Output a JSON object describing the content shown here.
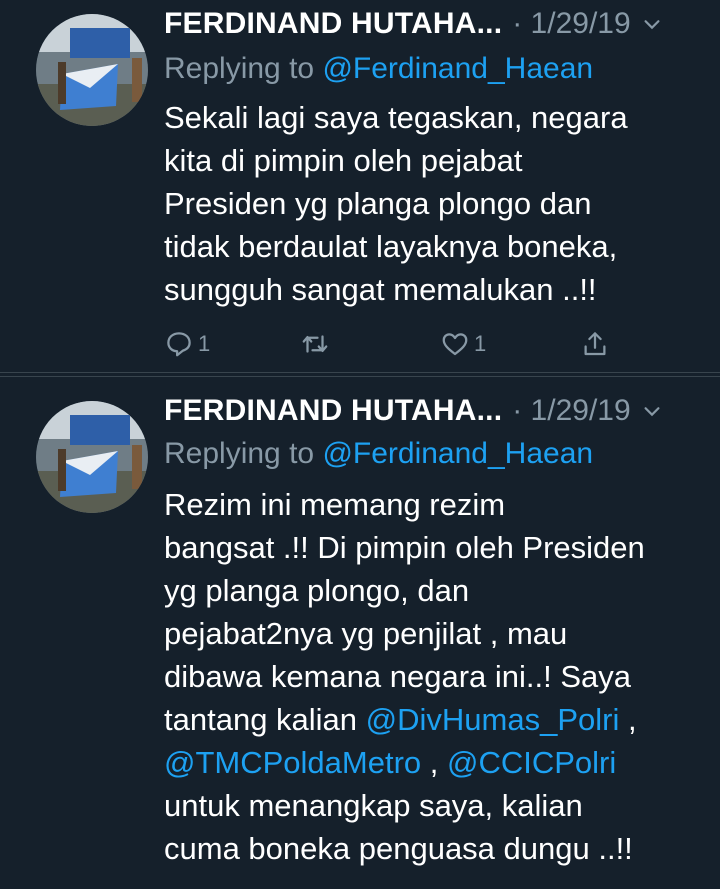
{
  "tweets": [
    {
      "author": "FERDINAND HUTAHA...",
      "date": "· 1/29/19",
      "replying_prefix": "Replying to",
      "replying_handle": "@Ferdinand_Haean",
      "body_lines": [
        "Sekali lagi saya tegaskan, negara",
        "kita di pimpin oleh pejabat",
        "Presiden yg planga plongo dan",
        "tidak berdaulat layaknya boneka,",
        "sungguh sangat memalukan ..!!"
      ],
      "actions": {
        "reply_count": "1",
        "retweet_count": "",
        "like_count": "1"
      }
    },
    {
      "author": "FERDINAND HUTAHA...",
      "date": "· 1/29/19",
      "replying_prefix": "Replying to",
      "replying_handle": "@Ferdinand_Haean",
      "body": {
        "l1": "Rezim ini memang rezim",
        "l2": "bangsat .!! Di pimpin oleh Presiden",
        "l3": "yg planga plongo,  dan",
        "l4": "pejabat2nya yg penjilat , mau",
        "l5": "dibawa kemana negara ini..! Saya",
        "l6_text": "tantang kalian ",
        "l6_mention": "@DivHumas_Polri",
        "l6_after": " ,",
        "l7_mention1": "@TMCPoldaMetro",
        "l7_sep": " , ",
        "l7_mention2": "@CCICPolri",
        "l8": "untuk menangkap saya, kalian",
        "l9": "cuma boneka penguasa dungu ..!!"
      }
    }
  ],
  "colors": {
    "background": "#15202b",
    "divider": "#38444d",
    "secondary_text": "#8899a6",
    "link": "#1da1f2"
  },
  "icons": [
    "avatar-photo",
    "chevron-down-icon",
    "reply-icon",
    "retweet-icon",
    "like-icon",
    "share-icon"
  ]
}
